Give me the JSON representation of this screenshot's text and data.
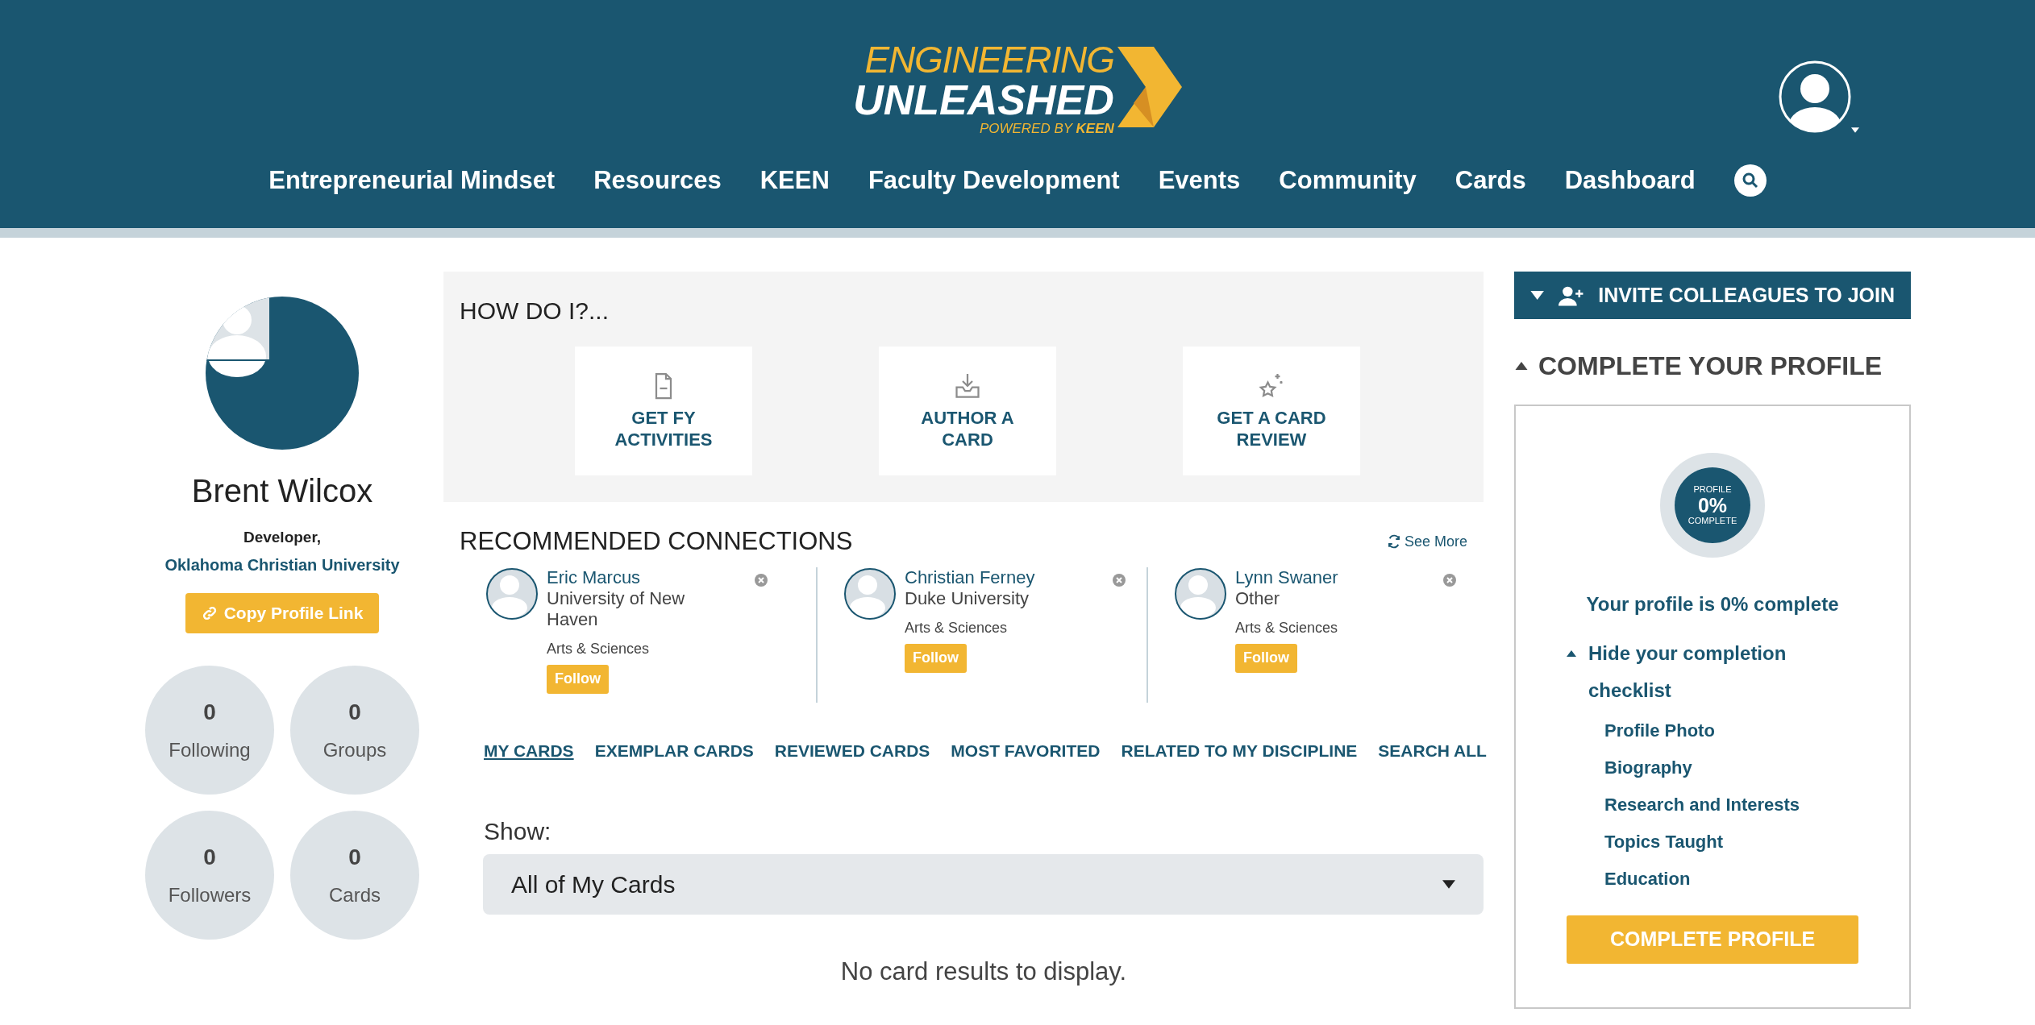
{
  "header": {
    "logo": {
      "line1": "ENGINEERING",
      "line2": "UNLEASHED",
      "tagline": "POWERED BY",
      "brand": "KEEN"
    },
    "nav": [
      {
        "label": "Entrepreneurial Mindset"
      },
      {
        "label": "Resources"
      },
      {
        "label": "KEEN"
      },
      {
        "label": "Faculty Development"
      },
      {
        "label": "Events"
      },
      {
        "label": "Community"
      },
      {
        "label": "Cards"
      },
      {
        "label": "Dashboard"
      }
    ]
  },
  "profile": {
    "name": "Brent Wilcox",
    "role": "Developer,",
    "organization": "Oklahoma Christian University",
    "copy_button": "Copy Profile Link",
    "stats": [
      {
        "value": "0",
        "label": "Following"
      },
      {
        "value": "0",
        "label": "Groups"
      },
      {
        "value": "0",
        "label": "Followers"
      },
      {
        "value": "0",
        "label": "Cards"
      }
    ]
  },
  "how_do_i": {
    "title": "HOW DO I?...",
    "actions": [
      {
        "kind": "document",
        "label": "GET FY ACTIVITIES"
      },
      {
        "kind": "download",
        "label": "AUTHOR A CARD"
      },
      {
        "kind": "star",
        "label": "GET A CARD REVIEW"
      }
    ]
  },
  "connections": {
    "title": "RECOMMENDED CONNECTIONS",
    "see_more": "See More",
    "people": [
      {
        "name": "Eric Marcus",
        "organization": "University of New Haven",
        "department": "Arts & Sciences",
        "follow": "Follow"
      },
      {
        "name": "Christian Ferney",
        "organization": "Duke University",
        "department": "Arts & Sciences",
        "follow": "Follow"
      },
      {
        "name": "Lynn Swaner",
        "organization": "Other",
        "department": "Arts & Sciences",
        "follow": "Follow"
      }
    ]
  },
  "card_tabs": [
    {
      "label": "MY CARDS",
      "selected": true
    },
    {
      "label": "EXEMPLAR CARDS",
      "selected": false
    },
    {
      "label": "REVIEWED CARDS",
      "selected": false
    },
    {
      "label": "MOST FAVORITED",
      "selected": false
    },
    {
      "label": "RELATED TO MY DISCIPLINE",
      "selected": false
    },
    {
      "label": "SEARCH ALL",
      "selected": false
    }
  ],
  "show": {
    "label": "Show:",
    "value": "All of My Cards"
  },
  "empty_message": "No card results to display.",
  "sidebar": {
    "invite": {
      "label": "INVITE COLLEAGUES TO JOIN",
      "expanded": false
    },
    "complete": {
      "title": "COMPLETE YOUR PROFILE",
      "expanded": true,
      "ring": {
        "top": "PROFILE",
        "percent": "0%",
        "bottom": "COMPLETE"
      },
      "status": "Your profile is 0% complete",
      "checklist_toggle": {
        "label": "Hide your completion checklist",
        "expanded": true
      },
      "checklist": [
        "Profile Photo",
        "Biography",
        "Research and Interests",
        "Topics Taught",
        "Education"
      ],
      "button": "COMPLETE PROFILE"
    }
  }
}
